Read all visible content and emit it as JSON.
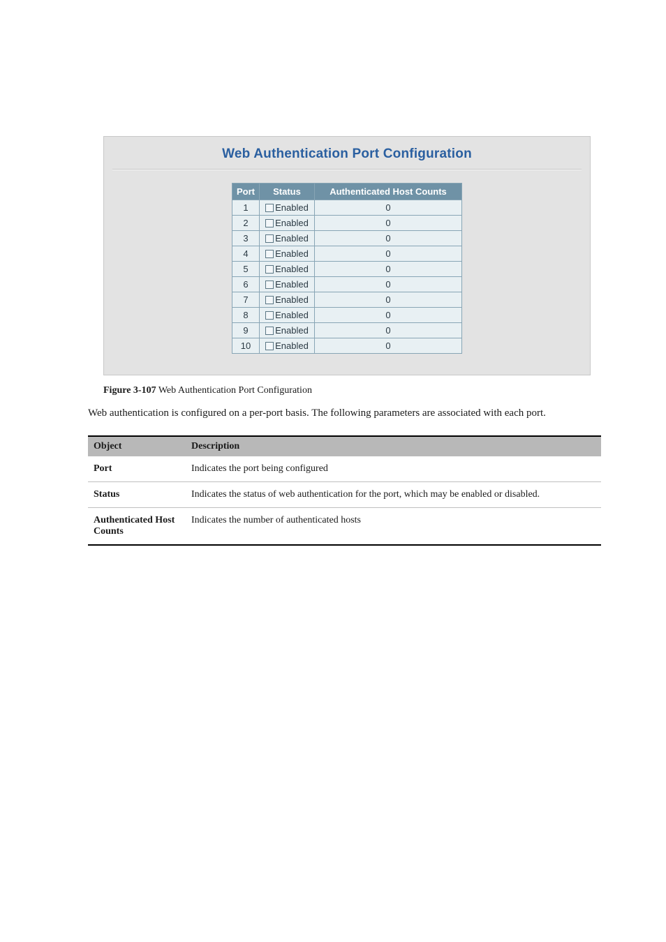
{
  "panel": {
    "title": "Web Authentication Port Configuration",
    "columns": [
      "Port",
      "Status",
      "Authenticated Host Counts"
    ],
    "status_label": "Enabled",
    "rows": [
      {
        "port": "1",
        "enabled": false,
        "count": "0"
      },
      {
        "port": "2",
        "enabled": false,
        "count": "0"
      },
      {
        "port": "3",
        "enabled": false,
        "count": "0"
      },
      {
        "port": "4",
        "enabled": false,
        "count": "0"
      },
      {
        "port": "5",
        "enabled": false,
        "count": "0"
      },
      {
        "port": "6",
        "enabled": false,
        "count": "0"
      },
      {
        "port": "7",
        "enabled": false,
        "count": "0"
      },
      {
        "port": "8",
        "enabled": false,
        "count": "0"
      },
      {
        "port": "9",
        "enabled": false,
        "count": "0"
      },
      {
        "port": "10",
        "enabled": false,
        "count": "0"
      }
    ]
  },
  "figure_caption": {
    "number": "Figure 3-107",
    "text": " Web Authentication Port Configuration"
  },
  "body_paragraph": "Web authentication is configured on a per-port basis. The following parameters are associated with each port.",
  "objects_table": {
    "header": [
      "Object",
      "Description"
    ],
    "rows": [
      {
        "term": "Port",
        "desc": "Indicates the port being configured"
      },
      {
        "term": "Status",
        "desc": "Indicates the status of web authentication for the port, which may be enabled or disabled."
      },
      {
        "term": "Authenticated Host Counts",
        "desc": "Indicates the number of authenticated hosts"
      }
    ]
  }
}
